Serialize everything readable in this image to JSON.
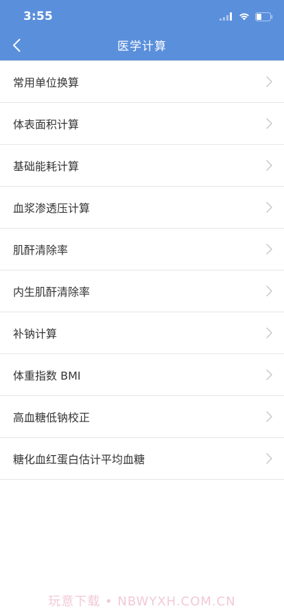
{
  "status_bar": {
    "time": "3:55"
  },
  "nav": {
    "title": "医学计算",
    "back_icon": "chevron-left-icon"
  },
  "items": [
    {
      "label": "常用单位换算"
    },
    {
      "label": "体表面积计算"
    },
    {
      "label": "基础能耗计算"
    },
    {
      "label": "血浆渗透压计算"
    },
    {
      "label": "肌酐清除率"
    },
    {
      "label": "内生肌酐清除率"
    },
    {
      "label": "补钠计算"
    },
    {
      "label": "体重指数 BMI"
    },
    {
      "label": "高血糖低钠校正"
    },
    {
      "label": "糖化血红蛋白估计平均血糖"
    }
  ],
  "watermark": "玩意下载 • NBWYXH.COM.CN",
  "colors": {
    "header_bg": "#5a8fdc",
    "text": "#333333",
    "divider": "#e6e6e6",
    "chevron": "#c7c7cc"
  }
}
